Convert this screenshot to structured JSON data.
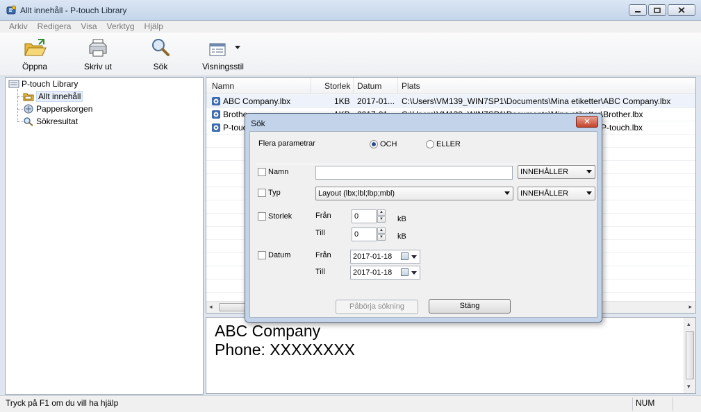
{
  "window": {
    "title": "Allt innehåll - P-touch Library"
  },
  "menu": [
    "Arkiv",
    "Redigera",
    "Visa",
    "Verktyg",
    "Hjälp"
  ],
  "toolbar": {
    "open": "Öppna",
    "print": "Skriv ut",
    "search": "Sök",
    "view_style": "Visningsstil"
  },
  "tree": {
    "root": "P-touch Library",
    "items": [
      "Allt innehåll",
      "Papperskorgen",
      "Sökresultat"
    ]
  },
  "list": {
    "columns": [
      "Namn",
      "Storlek",
      "Datum",
      "Plats"
    ],
    "rows": [
      {
        "name": "ABC Company.lbx",
        "size": "1KB",
        "date": "2017-01...",
        "location": "C:\\Users\\VM139_WIN7SP1\\Documents\\Mina etiketter\\ABC Company.lbx"
      },
      {
        "name": "Brothe",
        "size": "1KB",
        "date": "2017-01...",
        "location": "C:\\Users\\VM139_WIN7SP1\\Documents\\Mina etiketter\\Brother.lbx"
      },
      {
        "name": "P-touc",
        "size": "",
        "date": "",
        "location": "P-touch.lbx"
      }
    ]
  },
  "preview": {
    "line1": "ABC Company",
    "line2": "Phone: XXXXXXXX"
  },
  "status": {
    "help": "Tryck på F1 om du vill ha hjälp",
    "num": "NUM"
  },
  "dialog": {
    "title": "Sök",
    "close": "✕",
    "multi_params": "Flera parametrar",
    "opt_and": "OCH",
    "opt_or": "ELLER",
    "name_label": "Namn",
    "name_value": "",
    "name_cond": "INNEHÅLLER",
    "type_label": "Typ",
    "type_value": "Layout (lbx;lbl;lbp;mbl)",
    "type_cond": "INNEHÅLLER",
    "size_label": "Storlek",
    "from": "Från",
    "to": "Till",
    "size_from": "0",
    "size_to": "0",
    "kb": "kB",
    "date_label": "Datum",
    "date_from": "2017-01-18",
    "date_to": "2017-01-18",
    "start_search": "Påbörja sökning",
    "close_btn": "Stäng"
  }
}
